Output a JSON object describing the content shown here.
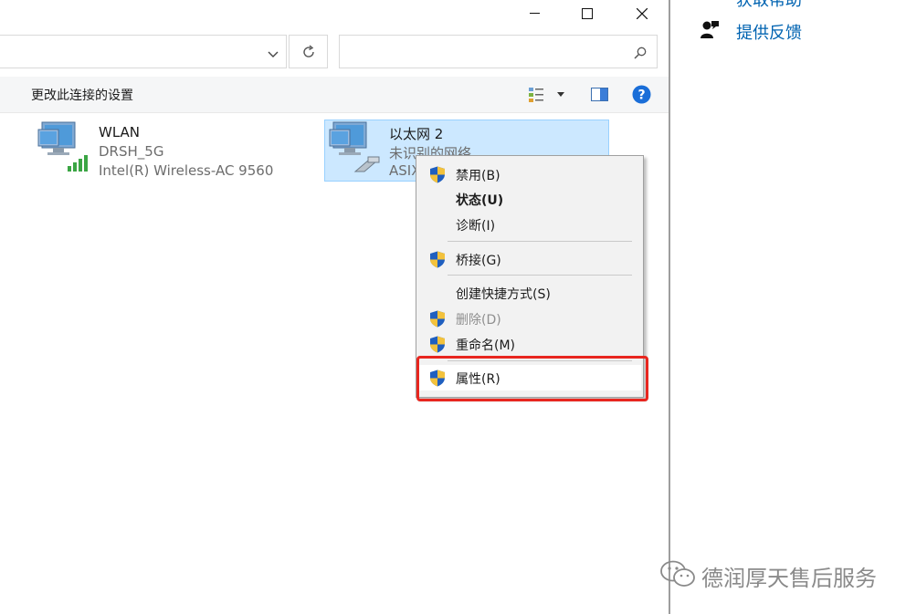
{
  "window_controls": {
    "minimize": "minimize",
    "maximize": "maximize",
    "close": "close"
  },
  "address_bar": {
    "value": "",
    "placeholder": ""
  },
  "search_box": {
    "value": "",
    "placeholder": ""
  },
  "command_bar": {
    "change_settings_label": "更改此连接的设置"
  },
  "connections": [
    {
      "name": "WLAN",
      "status": "DRSH_5G",
      "device": "Intel(R) Wireless-AC 9560",
      "icon": "wifi-adapter-icon"
    },
    {
      "name": "以太网 2",
      "status": "未识别的网络",
      "device": "ASIX",
      "icon": "ethernet-adapter-icon",
      "selected": true
    }
  ],
  "context_menu": {
    "items": [
      {
        "label": "禁用(B)",
        "shield": true
      },
      {
        "label": "状态(U)",
        "bold": true
      },
      {
        "label": "诊断(I)"
      },
      {
        "label": "桥接(G)",
        "shield": true
      },
      {
        "label": "创建快捷方式(S)"
      },
      {
        "label": "删除(D)",
        "shield": true,
        "disabled": true
      },
      {
        "label": "重命名(M)",
        "shield": true
      },
      {
        "label": "属性(R)",
        "shield": true,
        "highlighted": true
      }
    ]
  },
  "right_pane": {
    "top_link_partial": "获取帮助",
    "feedback_link": "提供反馈"
  },
  "watermark": "德润厚天售后服务",
  "colors": {
    "accent": "#0063b1",
    "selection": "#cce8ff",
    "highlight_box": "#e8261f"
  }
}
